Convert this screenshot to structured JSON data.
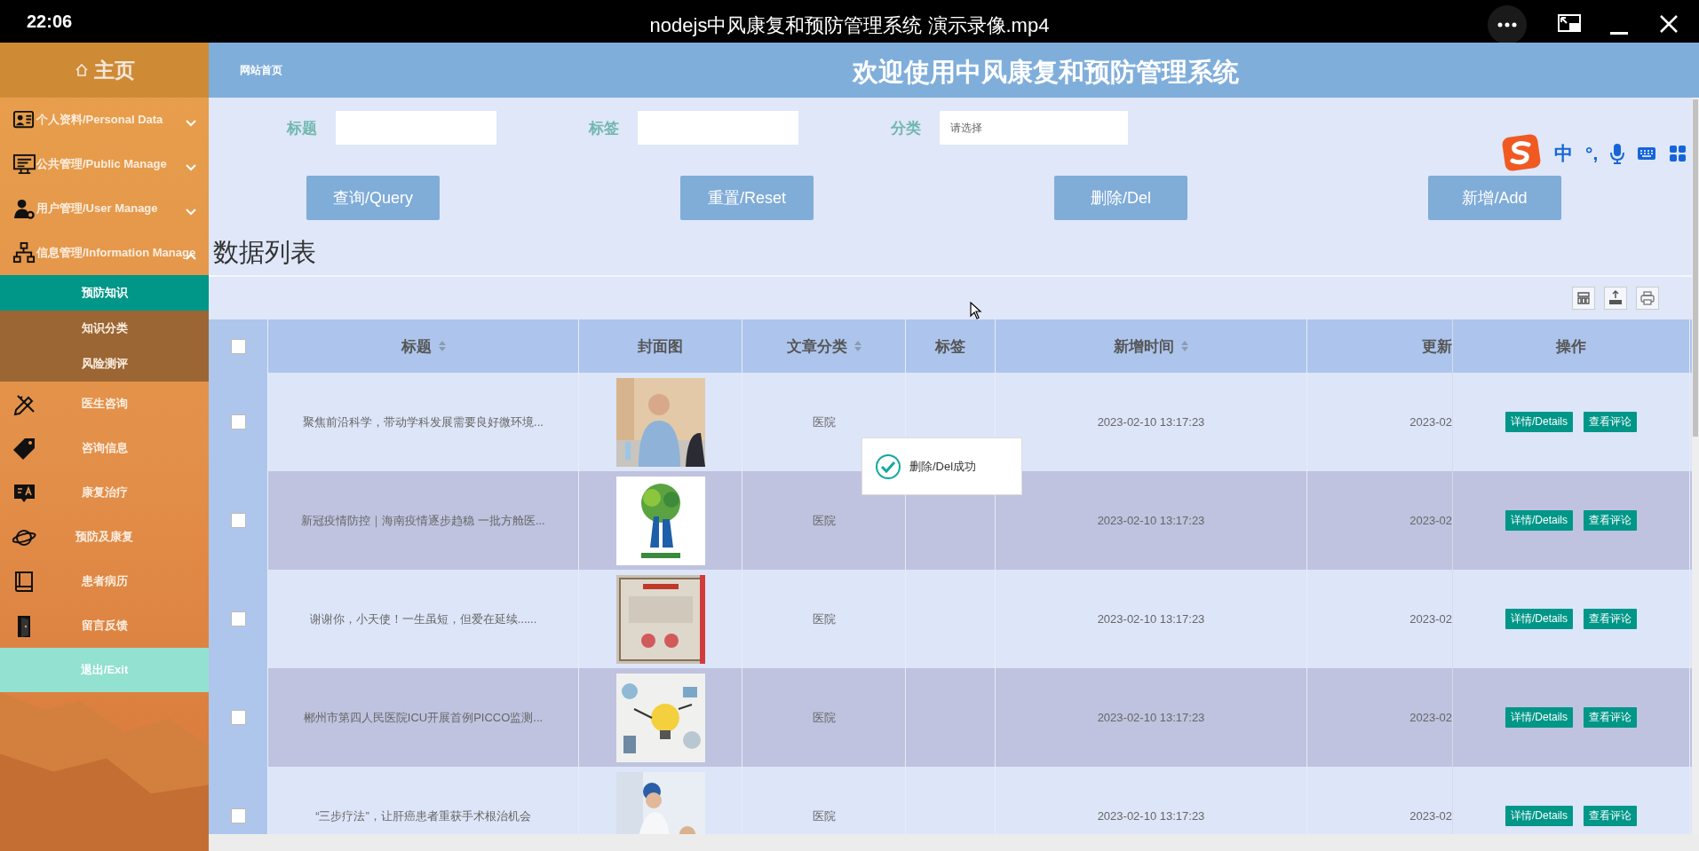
{
  "player": {
    "time": "22:06",
    "title": "nodejs中风康复和预防管理系统 演示录像.mp4"
  },
  "sidebar": {
    "home": "主页",
    "menus": [
      {
        "label": "个人资料/Personal Data",
        "expanded": false
      },
      {
        "label": "公共管理/Public Manage",
        "expanded": false
      },
      {
        "label": "用户管理/User Manage",
        "expanded": false
      },
      {
        "label": "信息管理/Information Manage",
        "expanded": true,
        "children": [
          {
            "label": "预防知识",
            "selected": true
          },
          {
            "label": "知识分类",
            "selected": false
          },
          {
            "label": "风险测评",
            "selected": false
          }
        ]
      }
    ],
    "links": [
      {
        "label": "医生咨询"
      },
      {
        "label": "咨询信息"
      },
      {
        "label": "康复治疗"
      },
      {
        "label": "预防及康复"
      },
      {
        "label": "患者病历"
      },
      {
        "label": "留言反馈"
      }
    ],
    "exit": "退出/Exit"
  },
  "header": {
    "breadcrumb": "网站首页",
    "title": "欢迎使用中风康复和预防管理系统"
  },
  "search": {
    "fields": [
      {
        "label": "标题"
      },
      {
        "label": "标签"
      },
      {
        "label": "分类",
        "placeholder": "请选择"
      }
    ],
    "buttons": [
      "查询/Query",
      "重置/Reset",
      "删除/Del",
      "新增/Add"
    ]
  },
  "list_title": "数据列表",
  "table": {
    "columns": [
      {
        "kind": "checkbox",
        "checked": false
      },
      {
        "kind": "text",
        "label": "标题",
        "sortable": true
      },
      {
        "kind": "text",
        "label": "封面图",
        "sortable": false
      },
      {
        "kind": "text",
        "label": "文章分类",
        "sortable": true
      },
      {
        "kind": "text",
        "label": "标签",
        "sortable": false
      },
      {
        "kind": "text",
        "label": "新增时间",
        "sortable": true
      },
      {
        "kind": "text",
        "label": "更新",
        "sortable": false
      },
      {
        "kind": "text",
        "label": "操作",
        "sortable": false
      }
    ],
    "rows": [
      {
        "checked": false,
        "title": "聚焦前沿科学，带动学科发展需要良好微环境...",
        "cover": {
          "kind": "picture"
        },
        "category": "医院",
        "created": "2023-02-10 13:17:23",
        "updated": "2023-02",
        "actions": [
          "详情/Details",
          "查看评论"
        ]
      },
      {
        "checked": false,
        "title": "新冠疫情防控｜海南疫情逐步趋稳 一批方舱医...",
        "cover": {
          "kind": "picture"
        },
        "category": "医院",
        "created": "2023-02-10 13:17:23",
        "updated": "2023-02",
        "actions": [
          "详情/Details",
          "查看评论"
        ]
      },
      {
        "checked": false,
        "title": "谢谢你，小天使！一生虽短，但爱在延续......",
        "cover": {
          "kind": "picture"
        },
        "category": "医院",
        "created": "2023-02-10 13:17:23",
        "updated": "2023-02",
        "actions": [
          "详情/Details",
          "查看评论"
        ]
      },
      {
        "checked": false,
        "title": "郴州市第四人民医院ICU开展首例PICCO监测...",
        "cover": {
          "kind": "picture"
        },
        "category": "医院",
        "created": "2023-02-10 13:17:23",
        "updated": "2023-02",
        "actions": [
          "详情/Details",
          "查看评论"
        ]
      },
      {
        "checked": false,
        "title": "“三步疗法”，让肝癌患者重获手术根治机会",
        "cover": {
          "kind": "picture"
        },
        "category": "医院",
        "created": "2023-02-10 13:17:23",
        "updated": "2023-02",
        "actions": [
          "详情/Details",
          "查看评论"
        ]
      }
    ]
  },
  "toast": {
    "message": "删除/Del成功"
  },
  "ime": {
    "mode": "中",
    "punctuation": "°,"
  }
}
